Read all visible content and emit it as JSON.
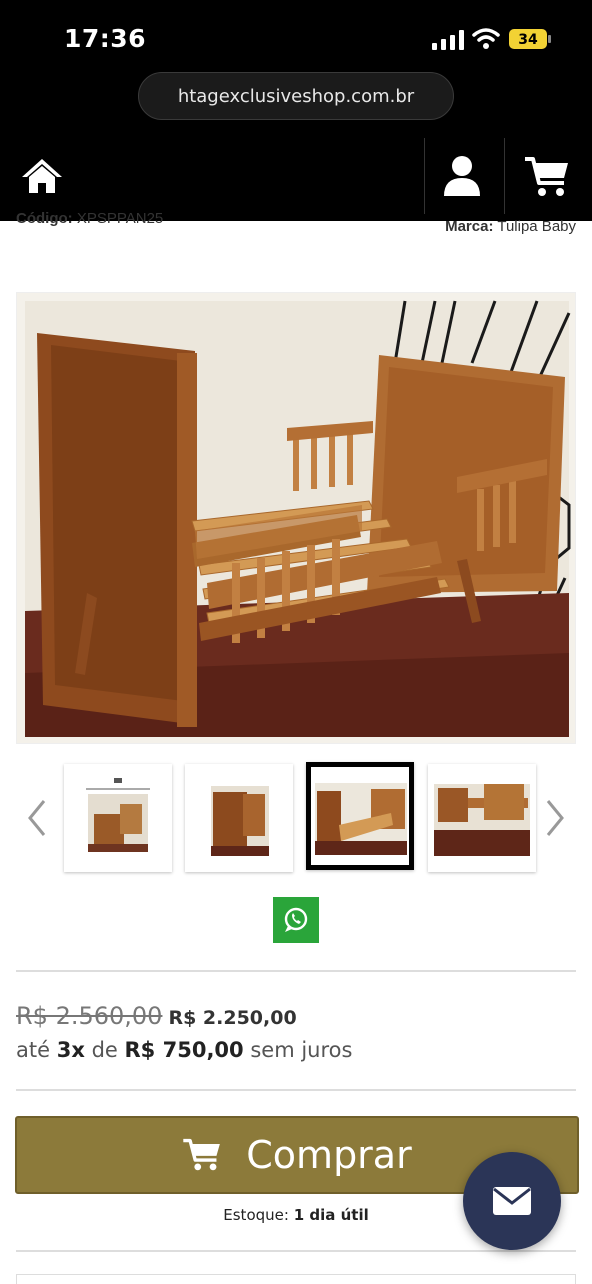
{
  "status_bar": {
    "time": "17:36",
    "battery": "34"
  },
  "browser": {
    "url": "htagexclusiveshop.com.br"
  },
  "product": {
    "codigo_label": "Código:",
    "codigo_value": "XPSPPAN25",
    "marca_label": "Marca:",
    "marca_value": "Tulipa Baby",
    "old_price": "R$ 2.560,00",
    "new_price": "R$ 2.250,00",
    "installment_prefix": "até",
    "installment_count": "3x",
    "installment_mid": "de",
    "installment_value": "R$ 750,00",
    "installment_suffix": "sem juros",
    "buy_label": "Comprar",
    "stock_label": "Estoque:",
    "stock_value": "1 dia útil"
  },
  "gallery": {
    "thumbnails": [
      "thumb-1",
      "thumb-2",
      "thumb-3",
      "thumb-4"
    ],
    "active_index": 2
  },
  "colors": {
    "buy_button": "#8c7a3a",
    "whatsapp": "#2aa53a",
    "chat_fab": "#2b3557",
    "wood": "#b0733a"
  },
  "icons": [
    "home-icon",
    "user-icon",
    "cart-icon",
    "chevron-left-icon",
    "chevron-right-icon",
    "whatsapp-icon",
    "mail-icon"
  ]
}
